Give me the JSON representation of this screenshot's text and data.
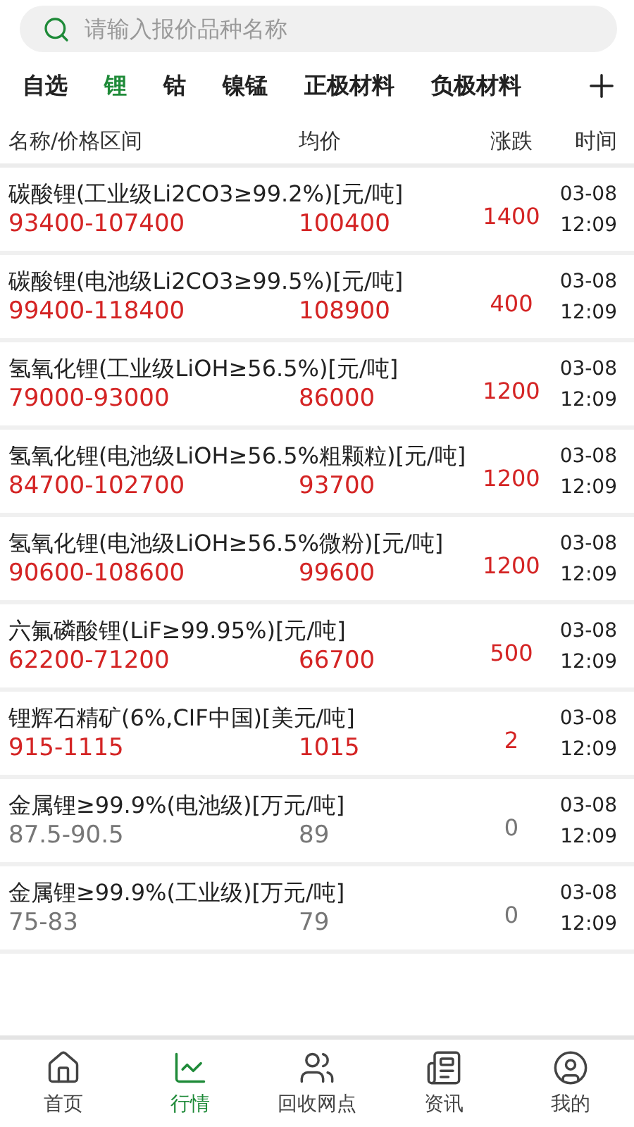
{
  "search": {
    "placeholder": "请输入报价品种名称"
  },
  "tabs": [
    {
      "label": "自选",
      "selected": false
    },
    {
      "label": "锂",
      "selected": true
    },
    {
      "label": "钴",
      "selected": false
    },
    {
      "label": "镍锰",
      "selected": false
    },
    {
      "label": "正极材料",
      "selected": false
    },
    {
      "label": "负极材料",
      "selected": false
    }
  ],
  "table": {
    "columns": [
      "名称/价格区间",
      "均价",
      "涨跌",
      "时间"
    ],
    "rows": [
      {
        "name": "碳酸锂(工业级Li2CO3≥99.2%)[元/吨]",
        "range": "93400-107400",
        "average": "100400",
        "change": "1400",
        "date": "03-08",
        "time": "12:09",
        "kind": "rising"
      },
      {
        "name": "碳酸锂(电池级Li2CO3≥99.5%)[元/吨]",
        "range": "99400-118400",
        "average": "108900",
        "change": "400",
        "date": "03-08",
        "time": "12:09",
        "kind": "rising"
      },
      {
        "name": "氢氧化锂(工业级LiOH≥56.5%)[元/吨]",
        "range": "79000-93000",
        "average": "86000",
        "change": "1200",
        "date": "03-08",
        "time": "12:09",
        "kind": "rising"
      },
      {
        "name": "氢氧化锂(电池级LiOH≥56.5%粗颗粒)[元/吨]",
        "range": "84700-102700",
        "average": "93700",
        "change": "1200",
        "date": "03-08",
        "time": "12:09",
        "kind": "rising"
      },
      {
        "name": "氢氧化锂(电池级LiOH≥56.5%微粉)[元/吨]",
        "range": "90600-108600",
        "average": "99600",
        "change": "1200",
        "date": "03-08",
        "time": "12:09",
        "kind": "rising"
      },
      {
        "name": "六氟磷酸锂(LiF≥99.95%)[元/吨]",
        "range": "62200-71200",
        "average": "66700",
        "change": "500",
        "date": "03-08",
        "time": "12:09",
        "kind": "rising"
      },
      {
        "name": "锂辉石精矿(6%,CIF中国)[美元/吨]",
        "range": "915-1115",
        "average": "1015",
        "change": "2",
        "date": "03-08",
        "time": "12:09",
        "kind": "rising"
      },
      {
        "name": "金属锂≥99.9%(电池级)[万元/吨]",
        "range": "87.5-90.5",
        "average": "89",
        "change": "0",
        "date": "03-08",
        "time": "12:09",
        "kind": "unchanged"
      },
      {
        "name": "金属锂≥99.9%(工业级)[万元/吨]",
        "range": "75-83",
        "average": "79",
        "change": "0",
        "date": "03-08",
        "time": "12:09",
        "kind": "unchanged"
      }
    ]
  },
  "nav": [
    {
      "label": "首页",
      "selected": false
    },
    {
      "label": "行情",
      "selected": true
    },
    {
      "label": "回收网点",
      "selected": false
    },
    {
      "label": "资讯",
      "selected": false
    },
    {
      "label": "我的",
      "selected": false
    }
  ]
}
